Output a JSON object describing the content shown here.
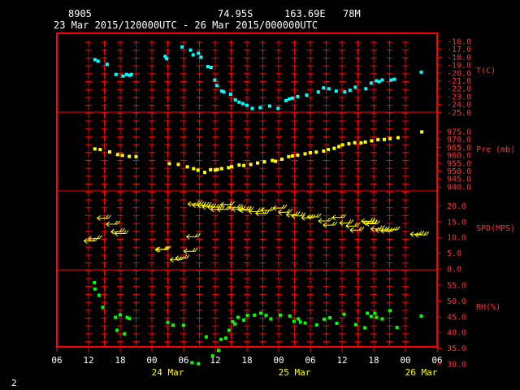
{
  "header": {
    "station": "8905",
    "lat": "74.95S",
    "lon": "163.69E",
    "elev": "78M",
    "period": "23 Mar 2015/120000UTC - 26 Mar 2015/000000UTC"
  },
  "page_number": "2",
  "chart_data": {
    "type": "scatter",
    "x_unit": "hours since 23 Mar 2015 00 UTC",
    "xlim": [
      6,
      78
    ],
    "x_tick_labels": [
      "06",
      "12",
      "18",
      "00",
      "06",
      "12",
      "18",
      "00",
      "06",
      "12",
      "18",
      "00",
      "06"
    ],
    "date_labels": [
      {
        "label": "24 Mar",
        "x": 27
      },
      {
        "label": "25 Mar",
        "x": 51
      },
      {
        "label": "26 Mar",
        "x": 75
      }
    ],
    "colors": {
      "frame": "#ff0000",
      "temp": "#00ffff",
      "pres": "#ffff00",
      "wind": "#ffff00",
      "rh": "#00ff00",
      "axis_text": "#ffffff"
    },
    "panels": [
      {
        "name": "T(C)",
        "ylim": [
          -25,
          -15
        ],
        "tick_labels": [
          "-16.0",
          "-17.0",
          "-18.0",
          "-19.0",
          "-20.0",
          "-21.0",
          "-22.0",
          "-23.0",
          "-24.0",
          "-25.0"
        ],
        "points": [
          [
            13.2,
            -18.3
          ],
          [
            13.8,
            -18.5
          ],
          [
            15.5,
            -18.9
          ],
          [
            17.2,
            -20.2
          ],
          [
            18.5,
            -20.4
          ],
          [
            19.2,
            -20.2
          ],
          [
            19.8,
            -20.3
          ],
          [
            20.1,
            -20.2
          ],
          [
            26.5,
            -17.9
          ],
          [
            26.8,
            -18.2
          ],
          [
            29.7,
            -16.7
          ],
          [
            31.3,
            -17.1
          ],
          [
            31.8,
            -17.7
          ],
          [
            32.8,
            -17.5
          ],
          [
            33.3,
            -18.0
          ],
          [
            34.6,
            -19.2
          ],
          [
            35.2,
            -19.3
          ],
          [
            35.9,
            -20.9
          ],
          [
            36.3,
            -21.6
          ],
          [
            37.2,
            -22.3
          ],
          [
            37.6,
            -22.4
          ],
          [
            38.9,
            -22.7
          ],
          [
            39.8,
            -23.4
          ],
          [
            40.5,
            -23.7
          ],
          [
            41.2,
            -23.9
          ],
          [
            42.0,
            -24.1
          ],
          [
            43.0,
            -24.5
          ],
          [
            44.5,
            -24.4
          ],
          [
            46.3,
            -24.2
          ],
          [
            47.9,
            -24.5
          ],
          [
            49.4,
            -23.5
          ],
          [
            50.0,
            -23.3
          ],
          [
            50.6,
            -23.2
          ],
          [
            51.6,
            -23.0
          ],
          [
            53.3,
            -22.8
          ],
          [
            55.5,
            -22.4
          ],
          [
            56.5,
            -21.9
          ],
          [
            57.5,
            -22.0
          ],
          [
            58.9,
            -22.3
          ],
          [
            60.5,
            -22.4
          ],
          [
            61.5,
            -22.2
          ],
          [
            62.5,
            -21.8
          ],
          [
            64.5,
            -22.0
          ],
          [
            65.5,
            -21.3
          ],
          [
            66.5,
            -21.0
          ],
          [
            67.0,
            -21.1
          ],
          [
            67.6,
            -20.9
          ],
          [
            69.3,
            -20.9
          ],
          [
            69.9,
            -20.8
          ],
          [
            75.0,
            -19.9
          ]
        ]
      },
      {
        "name": "Pre (mb)",
        "ylim": [
          940,
          980
        ],
        "tick_labels": [
          "975.0",
          "970.0",
          "965.0",
          "960.0",
          "955.0",
          "950.0",
          "945.0",
          "940.0"
        ],
        "points": [
          [
            13.2,
            964.0
          ],
          [
            14.2,
            963.6
          ],
          [
            16.0,
            962.1
          ],
          [
            17.5,
            960.4
          ],
          [
            18.4,
            959.9
          ],
          [
            19.7,
            959.3
          ],
          [
            21.0,
            959.1
          ],
          [
            27.3,
            954.7
          ],
          [
            29.0,
            954.2
          ],
          [
            30.7,
            952.7
          ],
          [
            31.9,
            951.5
          ],
          [
            32.7,
            950.5
          ],
          [
            34.0,
            949.1
          ],
          [
            35.1,
            950.8
          ],
          [
            36.0,
            950.6
          ],
          [
            36.4,
            951.0
          ],
          [
            37.2,
            951.5
          ],
          [
            38.5,
            952.1
          ],
          [
            39.1,
            952.8
          ],
          [
            40.5,
            953.8
          ],
          [
            41.4,
            953.5
          ],
          [
            42.7,
            954.2
          ],
          [
            44.0,
            955.1
          ],
          [
            45.3,
            955.8
          ],
          [
            46.8,
            956.7
          ],
          [
            47.4,
            956.2
          ],
          [
            48.6,
            957.5
          ],
          [
            49.9,
            959.1
          ],
          [
            50.6,
            959.6
          ],
          [
            51.6,
            960.1
          ],
          [
            53.0,
            960.9
          ],
          [
            54.0,
            961.6
          ],
          [
            55.1,
            962.0
          ],
          [
            56.5,
            962.7
          ],
          [
            57.4,
            963.6
          ],
          [
            58.5,
            964.4
          ],
          [
            59.4,
            965.5
          ],
          [
            60.1,
            966.6
          ],
          [
            61.3,
            967.3
          ],
          [
            62.4,
            968.0
          ],
          [
            63.6,
            967.9
          ],
          [
            64.4,
            968.4
          ],
          [
            65.6,
            969.1
          ],
          [
            66.8,
            969.9
          ],
          [
            68.0,
            970.0
          ],
          [
            69.1,
            970.6
          ],
          [
            70.6,
            971.2
          ],
          [
            75.1,
            974.8
          ]
        ]
      },
      {
        "name": "SPD(MPS)",
        "ylim": [
          0,
          25
        ],
        "tick_labels": [
          "20.0",
          "15.0",
          "10.0",
          "5.0",
          "0.0"
        ],
        "points": [
          [
            12.2,
            8.9
          ],
          [
            13.0,
            9.6
          ],
          [
            14.7,
            16.1
          ],
          [
            16.4,
            14.2
          ],
          [
            17.3,
            11.8
          ],
          [
            18.0,
            11.2
          ],
          [
            25.7,
            6.1
          ],
          [
            26.0,
            6.2
          ],
          [
            28.5,
            2.9
          ],
          [
            29.5,
            3.4
          ],
          [
            31.1,
            5.6
          ],
          [
            31.6,
            10.2
          ],
          [
            31.9,
            20.6
          ],
          [
            32.7,
            20.2
          ],
          [
            33.7,
            20.1
          ],
          [
            34.6,
            19.7
          ],
          [
            35.6,
            19.6
          ],
          [
            36.2,
            18.9
          ],
          [
            37.4,
            18.9
          ],
          [
            38.1,
            20.4
          ],
          [
            39.6,
            19.5
          ],
          [
            40.2,
            19.0
          ],
          [
            41.3,
            18.9
          ],
          [
            41.7,
            18.6
          ],
          [
            43.4,
            18.2
          ],
          [
            44.7,
            17.6
          ],
          [
            45.7,
            18.6
          ],
          [
            48.0,
            19.3
          ],
          [
            49.0,
            18.0
          ],
          [
            50.5,
            17.2
          ],
          [
            51.5,
            16.8
          ],
          [
            53.4,
            16.2
          ],
          [
            54.5,
            16.5
          ],
          [
            56.6,
            15.2
          ],
          [
            57.5,
            13.9
          ],
          [
            59.2,
            16.3
          ],
          [
            60.6,
            14.6
          ],
          [
            61.8,
            13.6
          ],
          [
            62.6,
            12.3
          ],
          [
            64.7,
            15.1
          ],
          [
            65.1,
            14.6
          ],
          [
            65.6,
            14.3
          ],
          [
            66.5,
            12.7
          ],
          [
            67.4,
            12.3
          ],
          [
            68.4,
            12.0
          ],
          [
            69.4,
            12.4
          ],
          [
            74.0,
            11.0
          ],
          [
            74.9,
            10.8
          ]
        ]
      },
      {
        "name": "RH(%)",
        "ylim": [
          30,
          60
        ],
        "tick_labels": [
          "55.0",
          "50.0",
          "45.0",
          "40.0",
          "35.0",
          "30.0"
        ],
        "points": [
          [
            13.1,
            55.8
          ],
          [
            13.2,
            53.8
          ],
          [
            14.0,
            51.8
          ],
          [
            14.7,
            48.0
          ],
          [
            17.1,
            44.8
          ],
          [
            17.4,
            40.7
          ],
          [
            18.0,
            45.6
          ],
          [
            18.8,
            39.6
          ],
          [
            19.3,
            44.8
          ],
          [
            19.7,
            44.4
          ],
          [
            27.0,
            43.2
          ],
          [
            28.0,
            42.3
          ],
          [
            30.0,
            42.3
          ],
          [
            31.6,
            30.4
          ],
          [
            32.8,
            30.1
          ],
          [
            34.3,
            38.6
          ],
          [
            35.5,
            32.6
          ],
          [
            36.6,
            34.3
          ],
          [
            37.1,
            37.8
          ],
          [
            38.0,
            38.2
          ],
          [
            38.6,
            40.7
          ],
          [
            39.3,
            43.4
          ],
          [
            39.7,
            42.7
          ],
          [
            40.3,
            44.8
          ],
          [
            41.4,
            43.9
          ],
          [
            42.1,
            45.4
          ],
          [
            43.4,
            45.5
          ],
          [
            44.6,
            46.1
          ],
          [
            45.6,
            45.4
          ],
          [
            46.5,
            44.3
          ],
          [
            48.3,
            45.5
          ],
          [
            50.1,
            45.2
          ],
          [
            50.9,
            43.5
          ],
          [
            51.7,
            44.3
          ],
          [
            52.1,
            43.3
          ],
          [
            53.0,
            43.0
          ],
          [
            55.2,
            42.4
          ],
          [
            56.6,
            44.2
          ],
          [
            57.7,
            44.7
          ],
          [
            59.0,
            42.9
          ],
          [
            60.4,
            45.8
          ],
          [
            62.6,
            42.5
          ],
          [
            64.3,
            41.5
          ],
          [
            64.8,
            46.1
          ],
          [
            65.5,
            45.1
          ],
          [
            66.2,
            46.1
          ],
          [
            66.5,
            44.8
          ],
          [
            67.6,
            44.3
          ],
          [
            69.1,
            46.9
          ],
          [
            70.4,
            41.6
          ],
          [
            75.0,
            45.2
          ]
        ]
      }
    ]
  }
}
